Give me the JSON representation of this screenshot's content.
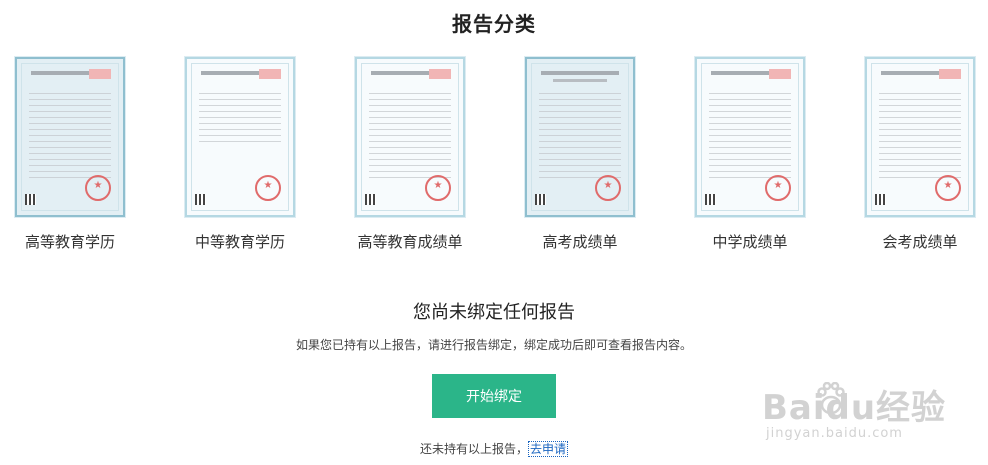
{
  "section_title": "报告分类",
  "categories": [
    {
      "label": "高等教育学历"
    },
    {
      "label": "中等教育学历"
    },
    {
      "label": "高等教育成绩单"
    },
    {
      "label": "高考成绩单"
    },
    {
      "label": "中学成绩单"
    },
    {
      "label": "会考成绩单"
    }
  ],
  "notice": {
    "title": "您尚未绑定任何报告",
    "description": "如果您已持有以上报告，请进行报告绑定，绑定成功后即可查看报告内容。"
  },
  "bind_button": {
    "label": "开始绑定"
  },
  "apply": {
    "prefix": "还未持有以上报告，",
    "link": "去申请"
  },
  "watermark": {
    "main": "Baidu经验",
    "sub": "jingyan.baidu.com"
  },
  "colors": {
    "accent": "#2bb589",
    "link": "#1a65c0"
  }
}
